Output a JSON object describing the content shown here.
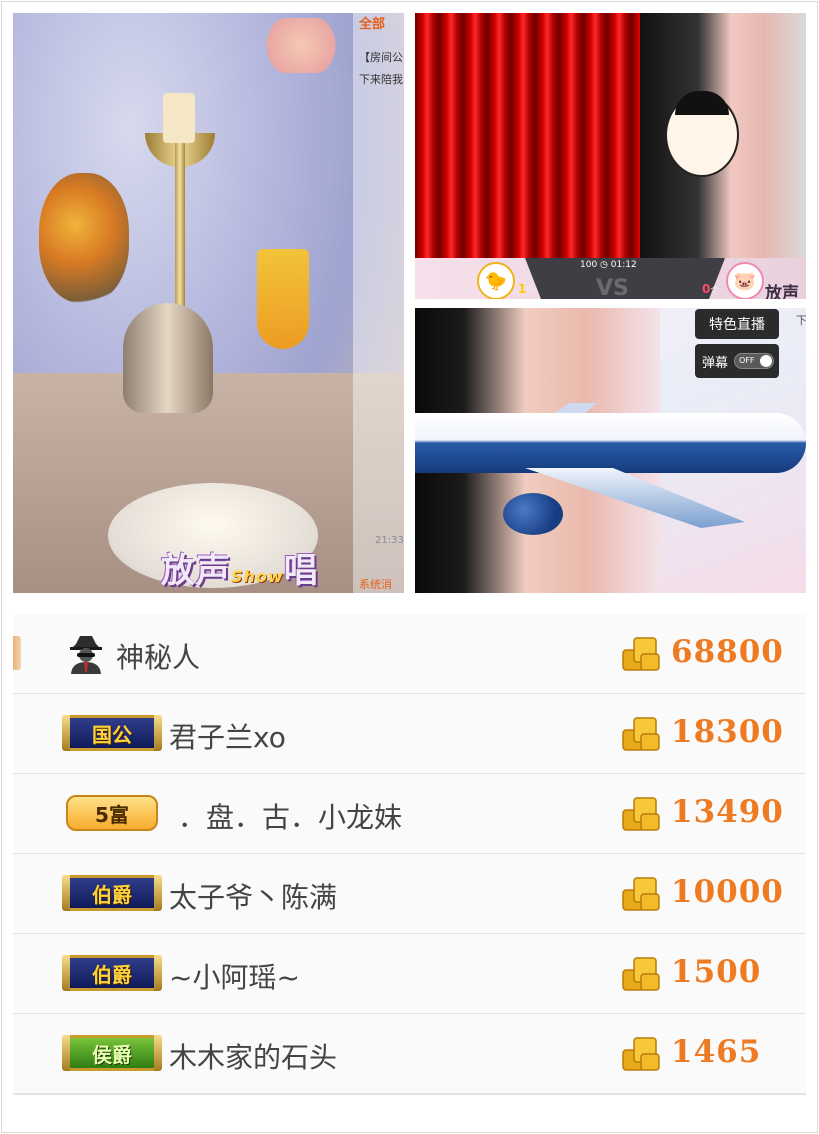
{
  "left_panel": {
    "room_tab_label": "全部",
    "chat_lines": [
      "【房间公",
      "下来陪我",
      "21:33"
    ],
    "system_label": "系统消",
    "watermark": {
      "main": "放声",
      "show": "Show",
      "suffix": "唱"
    }
  },
  "pk_panel": {
    "score_display": "100 ◷ 01:12",
    "vs_label": "VS",
    "left_count": "1",
    "right_count": "0",
    "count_unit": "个",
    "left_avatar_icon": "duck-icon",
    "right_avatar_icon": "pig-icon",
    "brand_text": "放声"
  },
  "stream_panel": {
    "special_live_button": "特色直播",
    "danmu_label": "弹幕",
    "danmu_toggle_state": "OFF",
    "edge_text": "下"
  },
  "ranking": {
    "accent_color": "#ee7a22",
    "rows": [
      {
        "badge_type": "mystery",
        "badge_text": "",
        "name": "神秘人",
        "amount": "68800"
      },
      {
        "badge_type": "noble",
        "badge_text": "国公",
        "name": "君子兰xo",
        "amount": "18300"
      },
      {
        "badge_type": "rich",
        "badge_text": "5富",
        "name": "．盘．古．小龙妹",
        "amount": "13490"
      },
      {
        "badge_type": "noble",
        "badge_text": "伯爵",
        "name": "太子爷丶陈满",
        "amount": "10000"
      },
      {
        "badge_type": "noble",
        "badge_text": "伯爵",
        "name": "~小阿瑶~",
        "amount": "1500"
      },
      {
        "badge_type": "green",
        "badge_text": "侯爵",
        "name": "木木家的石头",
        "amount": "1465"
      }
    ]
  }
}
